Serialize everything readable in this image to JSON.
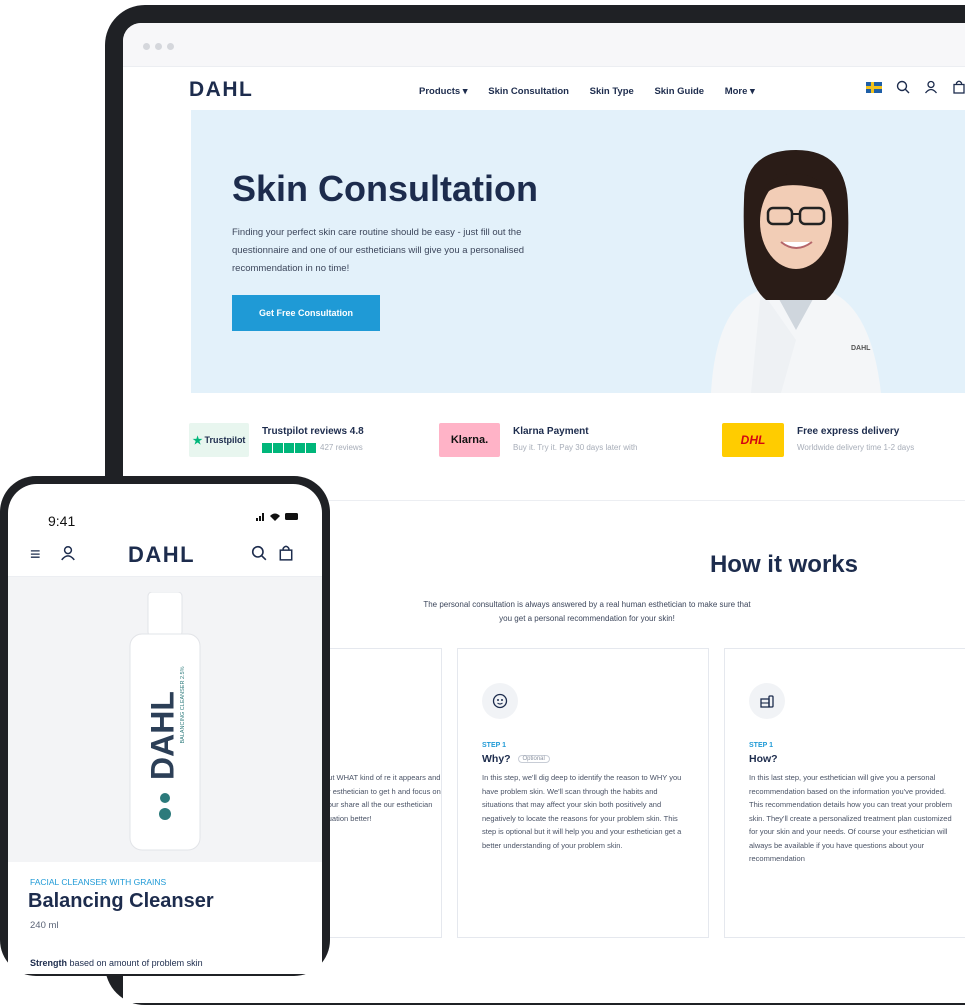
{
  "desktop": {
    "nav": {
      "logo": "DAHL",
      "menu": [
        "Products ▾",
        "Skin Consultation",
        "Skin Type",
        "Skin Guide",
        "More ▾"
      ]
    },
    "hero": {
      "title": "Skin Consultation",
      "text": "Finding your perfect skin care routine should be easy - just fill out the questionnaire and one of our estheticians will give you a personalised recommendation in no time!",
      "cta": "Get Free Consultation",
      "coat_logo": "DAHL"
    },
    "trust": [
      {
        "badge": "Trustpilot",
        "title": "Trustpilot reviews 4.8",
        "sub": "427 reviews"
      },
      {
        "badge": "Klarna.",
        "title": "Klarna Payment",
        "sub": "Buy it. Try it. Pay 30 days later with"
      },
      {
        "badge": "DHL",
        "title": "Free express delivery",
        "sub": "Worldwide delivery time 1-2 days"
      }
    ],
    "how": {
      "title": "How it works",
      "subtitle": "The personal consultation is always answered by a real human esthetician to make sure that you get a personal recommendation for your skin!",
      "cards": [
        {
          "step": "",
          "heading": "",
          "text": "out WHAT kind of re it appears and ur esthetician to get h and focus on your share all the our esthetician ituation better!"
        },
        {
          "step": "STEP 1",
          "heading": "Why?",
          "tag": "Optional",
          "text": "In this step, we'll dig deep to identify the reason to WHY you have problem skin. We'll scan through the habits and situations that may affect your skin both positively and negatively to locate the reasons for your problem skin. This step is optional but it will help you and your esthetician get a better understanding of your problem skin."
        },
        {
          "step": "STEP 1",
          "heading": "How?",
          "text": "In this last step, your esthetician will give you a personal recommendation based on the information you've provided. This recommendation details how you can treat your problem skin. They'll create a personalized treatment plan customized for your skin and your needs. Of course your esthetician will always be available if you have questions about your recommendation"
        }
      ]
    }
  },
  "phone": {
    "time": "9:41",
    "status_icons": ".ıl ▲ ▬",
    "logo": "DAHL",
    "product": {
      "category": "FACIAL CLEANSER WITH GRAINS",
      "name": "Balancing Cleanser",
      "volume": "240 ml",
      "strength_label": "Strength",
      "strength_text": "based on amount of problem skin",
      "bottle_brand": "DAHL",
      "bottle_label": "BALANCING CLEANSER 2.5%"
    }
  },
  "colors": {
    "accent": "#1f9ad6",
    "navy": "#1d2c4d",
    "hero_bg": "#e3f1fa",
    "trustpilot": "#00b67a",
    "klarna": "#ffb3c7",
    "dhl": "#ffcc00"
  },
  "icons": [
    "flag-sweden-icon",
    "search-icon",
    "user-icon",
    "bag-icon",
    "menu-icon",
    "face-scan-icon",
    "recommendation-icon",
    "star-icon"
  ]
}
